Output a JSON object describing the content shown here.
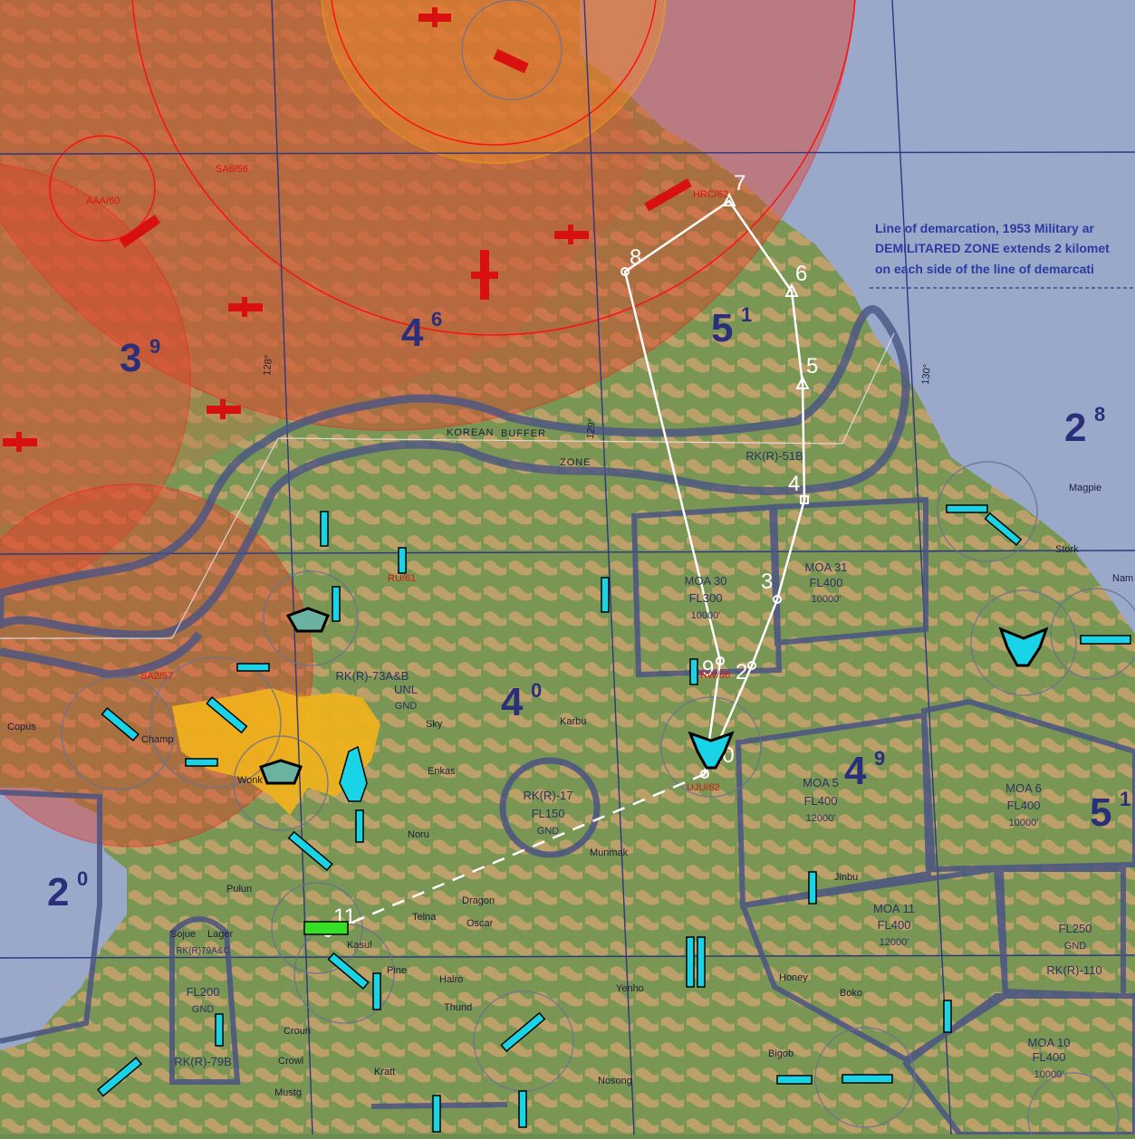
{
  "map": {
    "colors": {
      "land": "#6e8f4d",
      "hills": "#c9a56a",
      "sea": "#9aa9c9",
      "threat_fill": "#e0442c",
      "threat_ring": "#ff1010",
      "route": "#ffffff",
      "airspace": "#4a5483",
      "grid": "#2f3680",
      "icon_cyan": "#19d3e6",
      "airfield_yellow": "#f2b31c"
    },
    "note_lines": [
      "Line of demarcation, 1953 Military ar",
      "DEMILITARED ZONE extends 2 kilomet",
      "on each side of the line of demarcati"
    ],
    "dmz_words": [
      "KOREAN",
      "BUFFER",
      "ZONE"
    ],
    "meridians": [
      "128°",
      "129°",
      "130°"
    ],
    "threats": [
      {
        "label": "AAA/60"
      },
      {
        "label": "SA6/56"
      },
      {
        "label": "SA2/57"
      },
      {
        "label": "HRC/62"
      },
      {
        "label": "RU/61"
      },
      {
        "label": "RW/56"
      },
      {
        "label": "UJU/62"
      }
    ],
    "grid_numbers": [
      {
        "big": "4",
        "sup": "6"
      },
      {
        "big": "3",
        "sup": "9"
      },
      {
        "big": "5",
        "sup": "1"
      },
      {
        "big": "2",
        "sup": "8"
      },
      {
        "big": "4",
        "sup": "0"
      },
      {
        "big": "4",
        "sup": "9"
      },
      {
        "big": "5",
        "sup": "1"
      },
      {
        "big": "2",
        "sup": "0"
      }
    ],
    "airspace": [
      {
        "name": "MOA 30",
        "alt": "FL300",
        "floor": "10000'"
      },
      {
        "name": "MOA 31",
        "alt": "FL400",
        "floor": "10000'"
      },
      {
        "name": "MOA 5",
        "alt": "FL400",
        "floor": "12000'"
      },
      {
        "name": "MOA 6",
        "alt": "FL400",
        "floor": "10000'"
      },
      {
        "name": "MOA 11",
        "alt": "FL400",
        "floor": "12000'"
      },
      {
        "name": "MOA 10",
        "alt": "FL400",
        "floor": "10000'"
      },
      {
        "name": "RK(R)-17",
        "alt": "FL150",
        "floor": "GND"
      },
      {
        "name": "RK(R)-73A&B",
        "alt": "UNL",
        "floor": "GND"
      },
      {
        "name": "RK(R)-79B",
        "alt": "FL200",
        "floor": "GND"
      },
      {
        "name": "",
        "alt": "FL250",
        "floor": "GND"
      },
      {
        "name": "RK(R)-51B"
      },
      {
        "name": "RK(R)-110"
      },
      {
        "name": "RK(R)79A&C"
      }
    ],
    "places": [
      "Magpie",
      "Stork",
      "Nam",
      "Karbu",
      "Sky",
      "Enkas",
      "Noru",
      "Munmak",
      "Pulun",
      "Dragon",
      "Telna",
      "Oscar",
      "Kasul",
      "Pine",
      "Halro",
      "Thund",
      "Yenho",
      "Honey",
      "Boko",
      "Bigob",
      "Nosong",
      "Kratt",
      "Crowl",
      "Croun",
      "Mustg",
      "Copus",
      "Champ",
      "Wonk",
      "Jinbu",
      "Sojue",
      "Lager"
    ],
    "waypoints": [
      "2",
      "3",
      "4",
      "5",
      "6",
      "7",
      "8",
      "9",
      "10",
      "11"
    ]
  }
}
